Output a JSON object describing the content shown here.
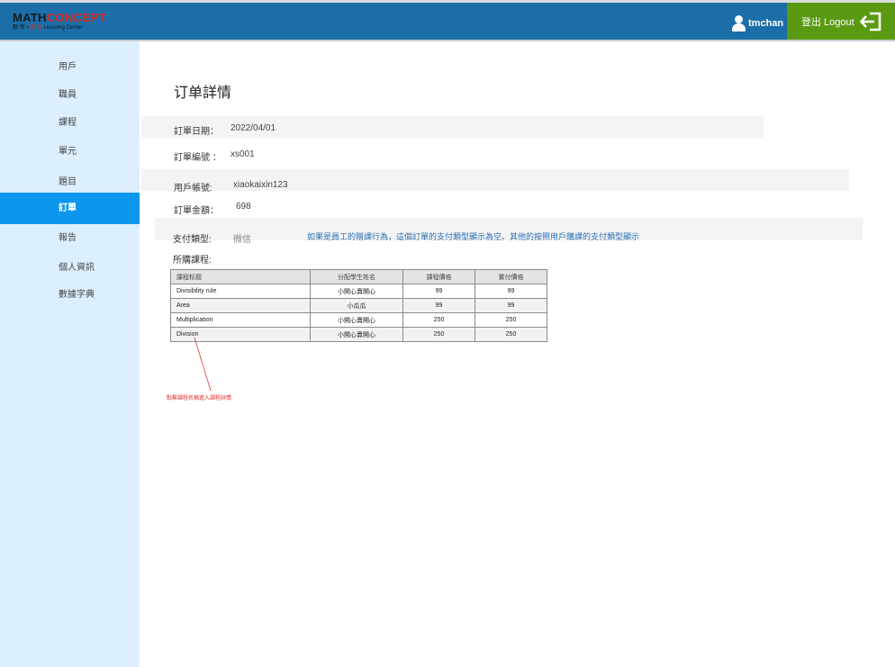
{
  "header": {
    "logo_main": "MATH",
    "logo_accent": "CONCEPT",
    "logo_sub_left": "數 學 •",
    "logo_sub_red": "概 念",
    "logo_sub_right": "Learning Center",
    "username": "tmchan",
    "logout_label": "登出 Logout",
    "colors": {
      "header_bg": "#1b6ea8",
      "logout_bg": "#5a9a13"
    },
    "icons": {
      "user": "user-icon",
      "logout": "logout-arrow-icon"
    }
  },
  "sidebar": {
    "items": [
      {
        "label": "用戶"
      },
      {
        "label": "職員"
      },
      {
        "label": "課程"
      },
      {
        "label": "單元"
      },
      {
        "label": "題目"
      },
      {
        "label": "訂單",
        "active": true
      },
      {
        "label": "報告"
      },
      {
        "label": "個人資訊"
      },
      {
        "label": "數據字典"
      }
    ],
    "active_color": "#0d96ee"
  },
  "order": {
    "title": "订单詳情",
    "date_label": "訂單日期：",
    "date_value": "2022/04/01",
    "number_label": "訂單編號 ：",
    "number_value": "xs001",
    "account_label": "用戶帳號:",
    "account_value": "xiaokaixin123",
    "amount_label": "訂單金額：",
    "amount_value": "698",
    "payment_label": "支付類型:",
    "payment_value": "微信",
    "payment_note": "如果是員工的贈課行為，這個訂單的支付類型顯示為空。其他的按照用戶購課的支付類型顯示",
    "courses_label": "所購課程:"
  },
  "courses": {
    "headers": [
      "課程标题",
      "分配學生姓名",
      "課程價格",
      "實付價格"
    ],
    "rows": [
      [
        "Divisibility rule",
        "小開心賣開心",
        "99",
        "99"
      ],
      [
        "Area",
        "小瓜瓜",
        "99",
        "99"
      ],
      [
        "Multiplication",
        "小開心賣開心",
        "250",
        "250"
      ],
      [
        "Division",
        "小開心賣開心",
        "250",
        "250"
      ]
    ]
  },
  "annotation": {
    "text": "點擊課程名稱進入課程詳情",
    "color": "#e03030"
  }
}
